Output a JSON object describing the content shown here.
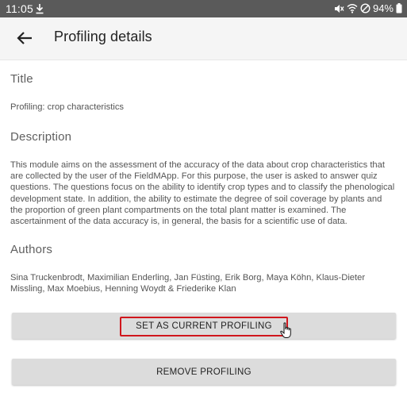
{
  "status_bar": {
    "time": "11:05",
    "battery": "94%",
    "icons": [
      "download-icon",
      "mute-icon",
      "wifi-icon",
      "do-not-disturb-icon",
      "battery-icon"
    ]
  },
  "app_bar": {
    "title": "Profiling details",
    "back_icon": "arrow-left-icon"
  },
  "sections": {
    "title": {
      "heading": "Title",
      "text": "Profiling: crop characteristics"
    },
    "description": {
      "heading": "Description",
      "text": "This module aims on the assessment of the accuracy of the data about crop characteristics that are collected by the user of the FieldMApp. For this purpose, the user is asked to answer quiz questions. The questions focus on the ability to identify crop types and to classify the phenological development state. In addition, the ability to estimate the degree of soil coverage by plants and the proportion of green plant compartments on the total plant matter is examined. The ascertainment of the data accuracy is, in general, the basis for a scientific use of data."
    },
    "authors": {
      "heading": "Authors",
      "text": "Sina Truckenbrodt, Maximilian Enderling, Jan Füsting, Erik Borg, Maya Köhn, Klaus-Dieter Missling, Max Moebius, Henning Woydt & Friederike Klan"
    }
  },
  "actions": {
    "set_current": "SET AS CURRENT PROFILING",
    "remove": "REMOVE PROFILING"
  },
  "colors": {
    "status_bar": "#5a5a5a",
    "app_bar": "#f5f5f5",
    "button": "#dcdcdc",
    "highlight": "#d0161d"
  }
}
